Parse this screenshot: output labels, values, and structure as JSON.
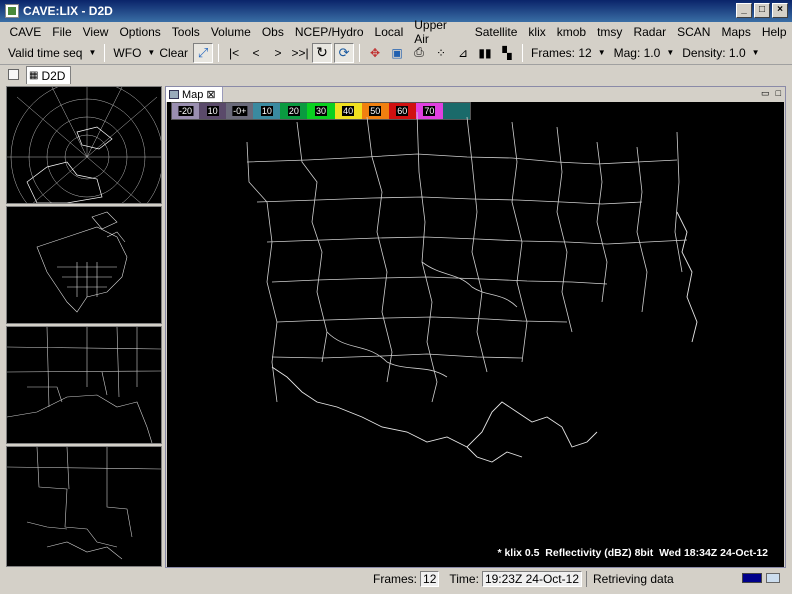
{
  "window": {
    "title": "CAVE:LIX - D2D"
  },
  "menu": [
    "CAVE",
    "File",
    "View",
    "Options",
    "Tools",
    "Volume",
    "Obs",
    "NCEP/Hydro",
    "Local",
    "Upper Air",
    "Satellite",
    "klix",
    "kmob",
    "tmsy",
    "Radar",
    "SCAN",
    "Maps",
    "Help"
  ],
  "toolbar": {
    "time_mode": "Valid time seq",
    "wfo": "WFO",
    "clear": "Clear",
    "frames": "Frames: 12",
    "mag": "Mag: 1.0",
    "density": "Density: 1.0"
  },
  "editor_tab": {
    "label": "D2D"
  },
  "map_tab": {
    "label": "Map",
    "close": "⊠"
  },
  "colorbar": {
    "labels": [
      "-20",
      "10",
      "-0+",
      "10",
      "20",
      "30",
      "40",
      "50",
      "60",
      "70",
      ""
    ],
    "colors": [
      "#9a8fb0",
      "#5a4a6a",
      "#6a6a7a",
      "#3a8aa0",
      "#0a9a40",
      "#0ad020",
      "#f0e020",
      "#f08010",
      "#d01010",
      "#e040e0",
      "#1a6a6a"
    ]
  },
  "product_label": "* klix 0.5  Reflectivity (dBZ) 8bit  Wed 18:34Z 24-Oct-12",
  "status": {
    "frames_label": "Frames:",
    "frames_value": "12",
    "time_label": "Time:",
    "time_value": "19:23Z 24-Oct-12",
    "message": "Retrieving data"
  }
}
